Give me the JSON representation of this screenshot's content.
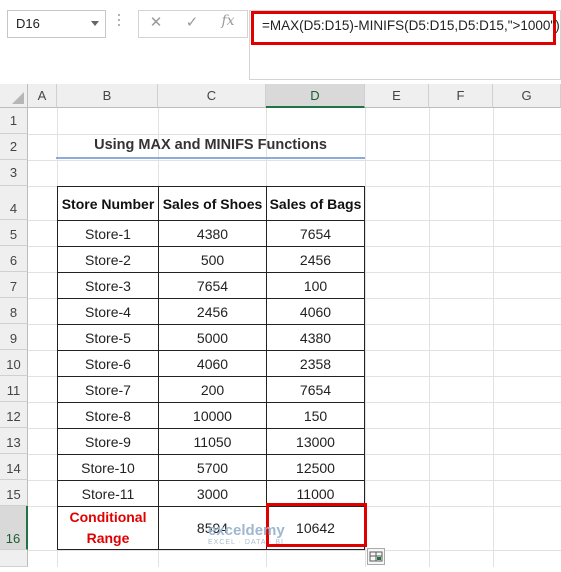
{
  "formula_bar": {
    "name_box": "D16",
    "cancel_icon": "✕",
    "enter_icon": "✓",
    "fx_label": "fx",
    "formula": "=MAX(D5:D15)-MINIFS(D5:D15,D5:D15,\">1000\")"
  },
  "columns": [
    "A",
    "B",
    "C",
    "D",
    "E",
    "F",
    "G"
  ],
  "selected_column": "D",
  "rows": [
    "1",
    "2",
    "3",
    "4",
    "5",
    "6",
    "7",
    "8",
    "9",
    "10",
    "11",
    "12",
    "13",
    "14",
    "15",
    "16"
  ],
  "selected_row": "16",
  "sheet": {
    "title": "Using MAX and MINIFS Functions",
    "table": {
      "headers": [
        "Store Number",
        "Sales of Shoes",
        "Sales of Bags"
      ],
      "rows": [
        [
          "Store-1",
          "4380",
          "7654"
        ],
        [
          "Store-2",
          "500",
          "2456"
        ],
        [
          "Store-3",
          "7654",
          "100"
        ],
        [
          "Store-4",
          "2456",
          "4060"
        ],
        [
          "Store-5",
          "5000",
          "4380"
        ],
        [
          "Store-6",
          "4060",
          "2358"
        ],
        [
          "Store-7",
          "200",
          "7654"
        ],
        [
          "Store-8",
          "10000",
          "150"
        ],
        [
          "Store-9",
          "11050",
          "13000"
        ],
        [
          "Store-10",
          "5700",
          "12500"
        ],
        [
          "Store-11",
          "3000",
          "11000"
        ]
      ],
      "result_label_line1": "Conditional",
      "result_label_line2": "Range",
      "result_shoes": "8594",
      "result_bags": "10642"
    }
  },
  "watermark": {
    "brand": "exceldemy",
    "tagline": "EXCEL · DATA · BI"
  },
  "colors": {
    "highlight_red": "#e00000",
    "excel_green": "#217346",
    "title_underline": "#8eaadb"
  }
}
